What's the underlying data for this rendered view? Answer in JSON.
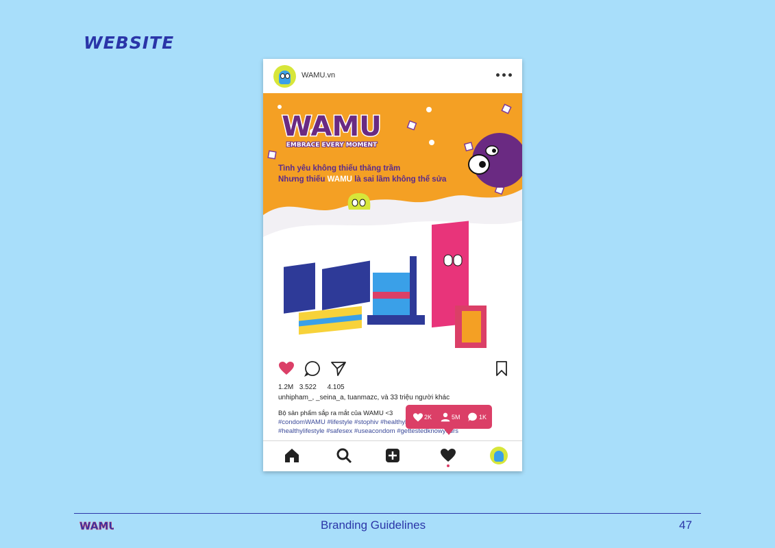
{
  "section_title": "WEBSITE",
  "post": {
    "username": "WAMU.vn",
    "poster": {
      "logo_text": "WAMU",
      "slogan": "EMBRACE EVERY MOMENT",
      "line1": "Tình yêu không thiếu thăng trầm",
      "line2_prefix": "Nhưng thiếu ",
      "line2_brand": "WAMU",
      "line2_suffix": " là sai lầm không thể sửa"
    },
    "counts": {
      "likes": "1.2M",
      "comments": "3.522",
      "shares": "4.105"
    },
    "liked_by": "unhipham_, _seina_a, tuanmazc, và 33 triệu người khác",
    "caption": "Bộ sản phẩm sắp ra mắt của WAMU <3",
    "tags_line1": "#condomWAMU #lifestyle #stophiv #healthylifestyle",
    "tags_line2": "#healthylifestyle #safesex #useacondom #gettestedknowyours"
  },
  "notification": {
    "likes": "2K",
    "followers": "5M",
    "comments": "1K"
  },
  "footer": {
    "logo_text": "WAMU",
    "title": "Branding Guidelines",
    "page": "47"
  },
  "colors": {
    "background": "#a8defa",
    "accent": "#db3f67",
    "brand_blue": "#2a35a8",
    "poster_orange": "#f4a024",
    "brand_purple": "#6a2a82"
  }
}
